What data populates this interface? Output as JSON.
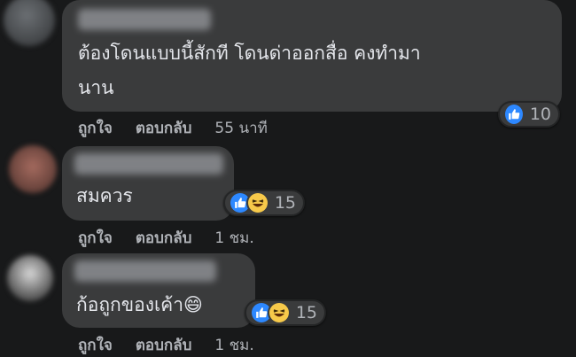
{
  "comments": [
    {
      "text_line1": "ต้องโดนแบบนี้สักที โดนด่าออกสื่อ คงทำมา",
      "text_line2": "นาน",
      "reaction_count": "10",
      "like_label": "ถูกใจ",
      "reply_label": "ตอบกลับ",
      "time": "55 นาที"
    },
    {
      "text": "สมควร",
      "reaction_count": "15",
      "like_label": "ถูกใจ",
      "reply_label": "ตอบกลับ",
      "time": "1 ชม."
    },
    {
      "text": "ก้อถูกของเค้า😄",
      "reaction_count": "15",
      "like_label": "ถูกใจ",
      "reply_label": "ตอบกลับ",
      "time": "1 ชม."
    }
  ],
  "colors": {
    "background": "#18191a",
    "bubble": "#3a3b3c",
    "text": "#e4e6eb",
    "secondary_text": "#b0b3b8",
    "like_blue": "#2d88ff",
    "haha_yellow": "#f7c94a"
  },
  "icons": [
    "like-icon",
    "haha-icon"
  ]
}
